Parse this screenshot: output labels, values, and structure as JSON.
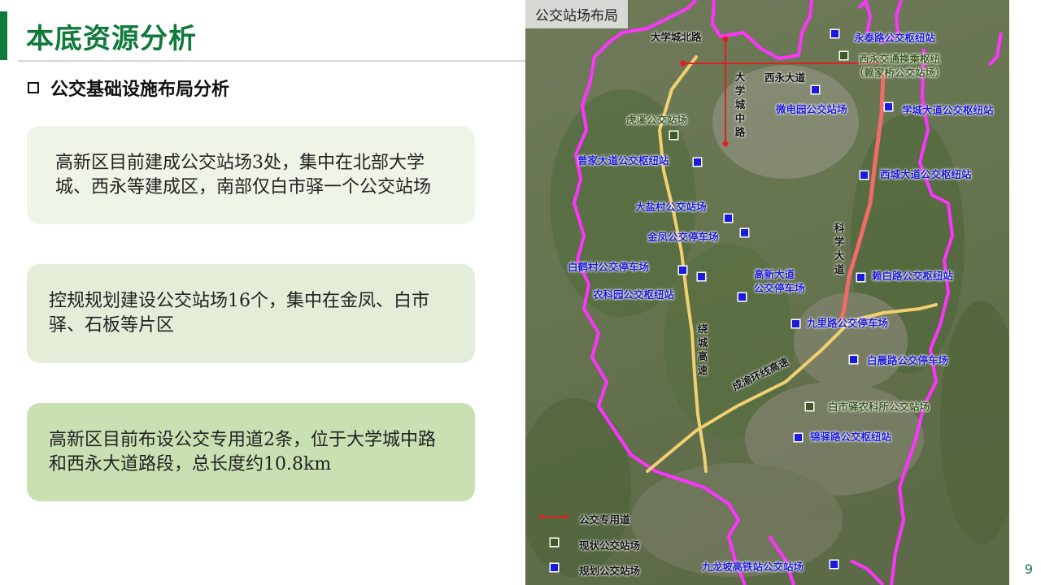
{
  "header": {
    "title": "本底资源分析"
  },
  "section": {
    "label": "公交基础设施布局分析"
  },
  "cards": [
    {
      "text": "高新区目前建成公交站场3处，集中在北部大学城、西永等建成区，南部仅白市驿一个公交站场"
    },
    {
      "text": "控规规划建设公交站场16个，集中在金凤、白市驿、石板等片区"
    },
    {
      "text": "高新区目前布设公交专用道2条，位于大学城中路和西永大道路段，总长度约10.8km"
    }
  ],
  "map": {
    "tag": "公交站场布局",
    "roads": {
      "daxuecheng_bei": "大学城北路",
      "daxuecheng_zhong": "大学城中路",
      "xiyong": "西永大道",
      "kexue": "科学大道",
      "raocheng": "绕城高速",
      "chengyu": "成渝环线高速"
    },
    "current_stations": {
      "xiyong_hub_1": "西永交通换乘枢纽",
      "xiyong_hub_2": "（赖家桥公交站场）",
      "huxi": "虎溪公交站场",
      "baishiyi": "白市驿农科所公交站场"
    },
    "planned_stations": {
      "yongtai": "永泰路公交枢纽站",
      "weidianyuan": "微电园公交站场",
      "xuecheng": "学城大道公交枢纽站",
      "zengjia": "曾家大道公交枢纽站",
      "xicheng": "西城大道公交枢纽站",
      "dayancun": "大盐村公交站场",
      "jinfeng": "金凤公交停车场",
      "baihecun": "白鹤村公交停车场",
      "gaoxin_1": "高新大道",
      "gaoxin_2": "公交停车场",
      "laibai": "赖白路公交枢纽站",
      "nongkeyuan": "农科园公交枢纽站",
      "jiuli": "九里路公交停车场",
      "baichen": "白晨路公交停车场",
      "jinyi": "锦驿路公交枢纽站",
      "jiulongpo": "九龙坡高铁站公交站场"
    },
    "legend": {
      "bus_lane": "公交专用道",
      "current": "现状公交站场",
      "planned": "规划公交站场"
    },
    "colors": {
      "bus_lane": "#e02020",
      "current_marker": "#3f5a28",
      "planned_marker": "#1a1ae0",
      "boundary": "#ff33ff",
      "highway": "#f0d070"
    }
  },
  "footer": {
    "page_number": "9"
  }
}
